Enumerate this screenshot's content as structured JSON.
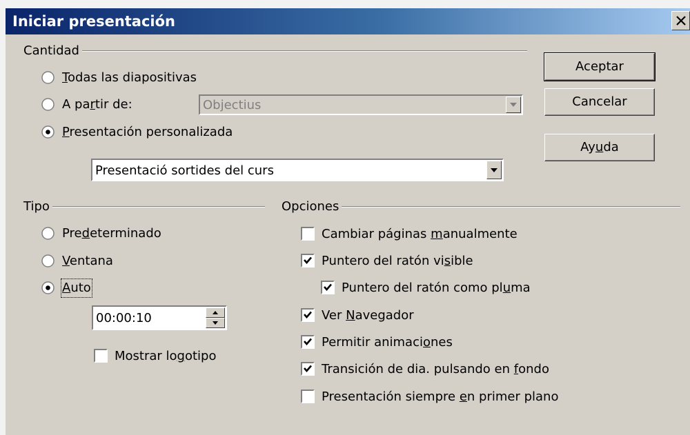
{
  "dialog": {
    "title": "Iniciar presentación"
  },
  "quantity": {
    "group_label": "Cantidad",
    "options": [
      {
        "label_pre": "",
        "label_key": "T",
        "label_post": "odas las diapositivas",
        "selected": false
      },
      {
        "label_pre": "A pa",
        "label_key": "r",
        "label_post": "tir de:",
        "selected": false
      },
      {
        "label_pre": "",
        "label_key": "P",
        "label_post": "resentación personalizada",
        "selected": true
      }
    ],
    "from_slide_value": "Objectius",
    "custom_show_value": "Presentació sortides del curs"
  },
  "buttons": {
    "ok": "Aceptar",
    "cancel": "Cancelar",
    "help_pre": "Ay",
    "help_key": "u",
    "help_post": "da"
  },
  "type": {
    "group_label": "Tipo",
    "options": [
      {
        "label_pre": "Pre",
        "label_key": "d",
        "label_post": "eterminado",
        "selected": false
      },
      {
        "label_pre": "",
        "label_key": "V",
        "label_post": "entana",
        "selected": false
      },
      {
        "label_pre": "",
        "label_key": "A",
        "label_post": "uto",
        "selected": true
      }
    ],
    "pause_value": "00:00:10",
    "show_logo_pre": "Mostrar lo",
    "show_logo_key": "g",
    "show_logo_post": "otipo",
    "show_logo_checked": false
  },
  "options": {
    "group_label": "Opciones",
    "items": [
      {
        "label_pre": "Cambiar páginas ",
        "label_key": "m",
        "label_post": "anualmente",
        "checked": false
      },
      {
        "label_pre": "Puntero del ratón vi",
        "label_key": "s",
        "label_post": "ible",
        "checked": true
      },
      {
        "label_pre": "Puntero del ratón como pl",
        "label_key": "u",
        "label_post": "ma",
        "checked": true
      },
      {
        "label_pre": "Ver ",
        "label_key": "N",
        "label_post": "avegador",
        "checked": true
      },
      {
        "label_pre": "Permitir animaci",
        "label_key": "o",
        "label_post": "nes",
        "checked": true
      },
      {
        "label_pre": "Transición de dia. pulsando en ",
        "label_key": "f",
        "label_post": "ondo",
        "checked": true
      },
      {
        "label_pre": "Presentación siempre ",
        "label_key": "e",
        "label_post": "n primer plano",
        "checked": false
      }
    ]
  },
  "icons": {
    "close": "close-icon",
    "dropdown": "chevron-down-icon",
    "spin_up": "spin-up-icon",
    "spin_down": "spin-down-icon",
    "check": "check-icon"
  }
}
